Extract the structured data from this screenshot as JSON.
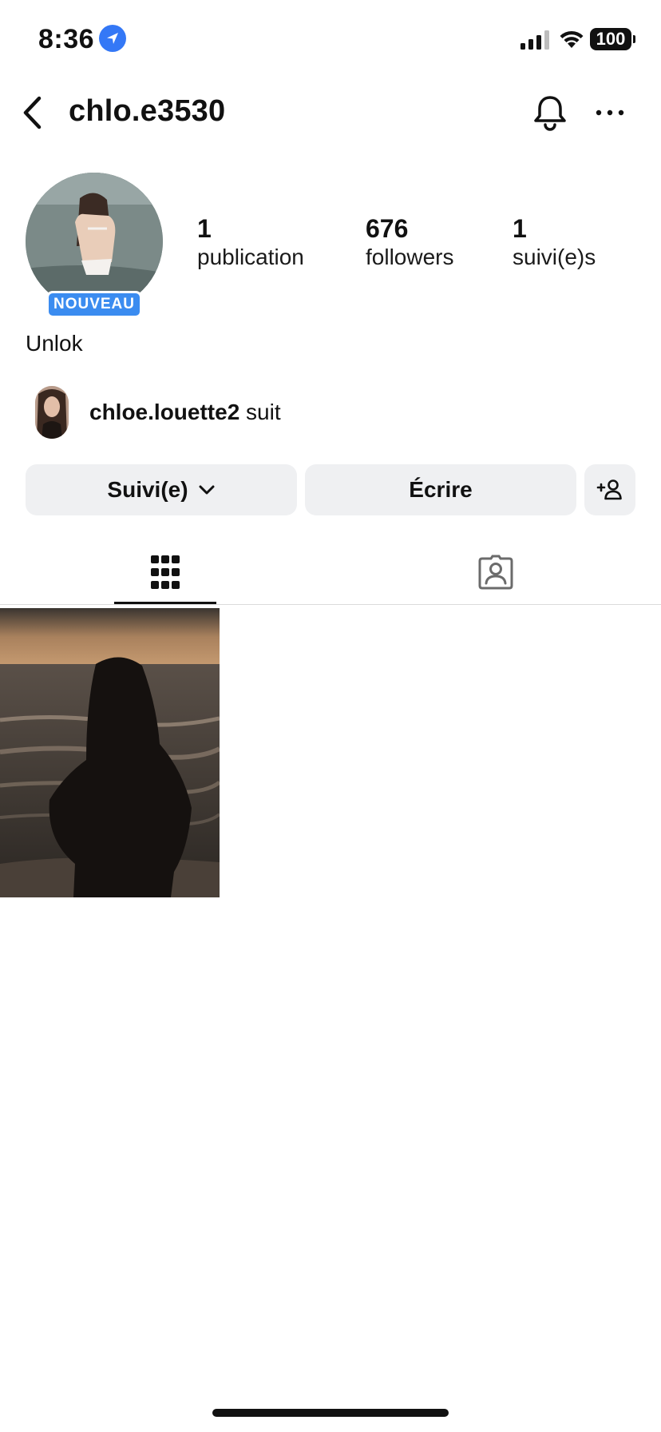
{
  "status_bar": {
    "time": "8:36",
    "battery": "100"
  },
  "header": {
    "username": "chlo.e3530"
  },
  "profile": {
    "badge": "NOUVEAU",
    "stats": [
      {
        "value": "1",
        "label": "publication"
      },
      {
        "value": "676",
        "label": "followers"
      },
      {
        "value": "1",
        "label": "suivi(e)s"
      }
    ],
    "bio": "Unlok",
    "followed_by": {
      "name": "chloe.louette2",
      "suffix": " suit"
    }
  },
  "actions": {
    "following_label": "Suivi(e)",
    "message_label": "Écrire"
  },
  "tabs": {
    "active": "grid"
  },
  "colors": {
    "accent": "#3b8cf0",
    "button_bg": "#eff0f2",
    "location_blue": "#3478f6"
  }
}
